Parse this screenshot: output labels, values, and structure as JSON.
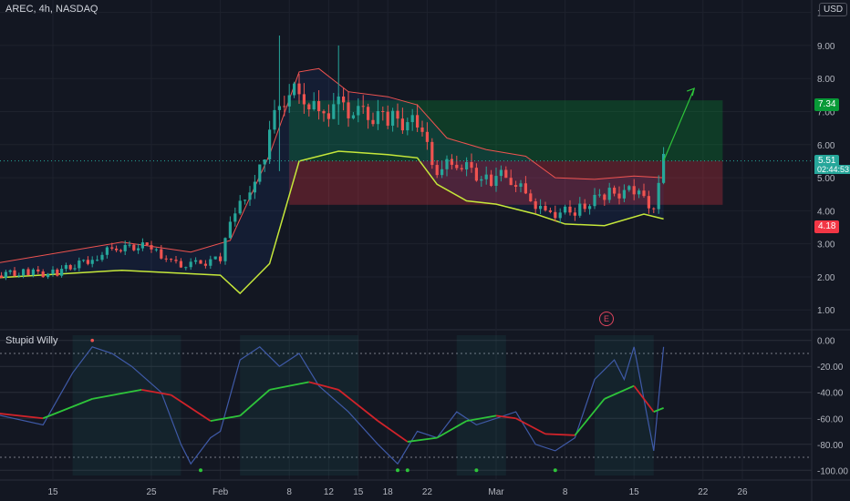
{
  "header": {
    "symbol": "AREC, 4h, NASDAQ",
    "currency": "USD"
  },
  "indicator": {
    "name": "Stupid Willy"
  },
  "price_tags": {
    "current": "5.51",
    "countdown": "02:44:53",
    "target": "7.34",
    "stop": "4.18"
  },
  "earnings_marker": "E",
  "colors": {
    "background": "#131722",
    "bull": "#26a69a",
    "bear": "#ef5350",
    "band_upper": "#ef5350",
    "band_lower": "#c6e83a",
    "osc": "#3f5aa8",
    "signal_green": "#2ec43a",
    "signal_red": "#d1232a",
    "target_zone": "#1b5e20",
    "stop_zone": "#7f1d1d"
  },
  "chart_data": [
    {
      "type": "candlestick",
      "title": "AREC, 4h, NASDAQ",
      "y_axis": {
        "ticks": [
          1.0,
          2.0,
          3.0,
          4.0,
          5.0,
          6.0,
          7.0,
          8.0,
          9.0,
          10.0
        ],
        "tick_labels": [
          "1.00",
          "2.00",
          "3.00",
          "4.00",
          "5.00",
          "6.00",
          "7.00",
          "8.00",
          "9.00",
          "10.00"
        ],
        "range": [
          0.4,
          10.1
        ]
      },
      "x_axis": {
        "tick_labels": [
          "15",
          "25",
          "Feb",
          "8",
          "12",
          "15",
          "18",
          "22",
          "Mar",
          "8",
          "15",
          "22",
          "26"
        ]
      },
      "close_path": [
        {
          "d": "2021-01-08",
          "v": 2.04
        },
        {
          "d": "2021-01-12",
          "v": 2.13
        },
        {
          "d": "2021-01-15",
          "v": 2.1
        },
        {
          "d": "2021-01-19",
          "v": 2.55
        },
        {
          "d": "2021-01-21",
          "v": 2.85
        },
        {
          "d": "2021-01-25",
          "v": 2.95
        },
        {
          "d": "2021-01-27",
          "v": 2.4
        },
        {
          "d": "2021-01-29",
          "v": 2.35
        },
        {
          "d": "2021-02-01",
          "v": 2.55
        },
        {
          "d": "2021-02-02",
          "v": 3.6
        },
        {
          "d": "2021-02-04",
          "v": 4.7
        },
        {
          "d": "2021-02-05",
          "v": 5.2
        },
        {
          "d": "2021-02-07",
          "v": 7.4
        },
        {
          "d": "2021-02-09",
          "v": 7.6
        },
        {
          "d": "2021-02-11",
          "v": 6.9
        },
        {
          "d": "2021-02-13",
          "v": 7.2
        },
        {
          "d": "2021-02-15",
          "v": 6.9
        },
        {
          "d": "2021-02-18",
          "v": 6.8
        },
        {
          "d": "2021-02-21",
          "v": 6.6
        },
        {
          "d": "2021-02-23",
          "v": 5.2
        },
        {
          "d": "2021-02-25",
          "v": 5.5
        },
        {
          "d": "2021-02-28",
          "v": 4.9
        },
        {
          "d": "2021-03-02",
          "v": 5.1
        },
        {
          "d": "2021-03-04",
          "v": 4.5
        },
        {
          "d": "2021-03-06",
          "v": 3.9
        },
        {
          "d": "2021-03-09",
          "v": 4.0
        },
        {
          "d": "2021-03-12",
          "v": 4.5
        },
        {
          "d": "2021-03-15",
          "v": 4.6
        },
        {
          "d": "2021-03-17",
          "v": 4.1
        },
        {
          "d": "2021-03-18",
          "v": 5.51
        }
      ],
      "bollinger_upper": [
        {
          "d": "2021-01-08",
          "v": 2.35
        },
        {
          "d": "2021-01-22",
          "v": 3.05
        },
        {
          "d": "2021-01-29",
          "v": 2.75
        },
        {
          "d": "2021-02-02",
          "v": 3.1
        },
        {
          "d": "2021-02-06",
          "v": 5.7
        },
        {
          "d": "2021-02-09",
          "v": 8.2
        },
        {
          "d": "2021-02-11",
          "v": 8.3
        },
        {
          "d": "2021-02-14",
          "v": 7.6
        },
        {
          "d": "2021-02-18",
          "v": 7.45
        },
        {
          "d": "2021-02-21",
          "v": 7.2
        },
        {
          "d": "2021-02-24",
          "v": 6.2
        },
        {
          "d": "2021-02-28",
          "v": 5.85
        },
        {
          "d": "2021-03-04",
          "v": 5.65
        },
        {
          "d": "2021-03-07",
          "v": 5.0
        },
        {
          "d": "2021-03-11",
          "v": 4.95
        },
        {
          "d": "2021-03-15",
          "v": 5.05
        },
        {
          "d": "2021-03-18",
          "v": 5.0
        }
      ],
      "bollinger_lower": [
        {
          "d": "2021-01-08",
          "v": 1.95
        },
        {
          "d": "2021-01-22",
          "v": 2.2
        },
        {
          "d": "2021-02-01",
          "v": 2.05
        },
        {
          "d": "2021-02-03",
          "v": 1.5
        },
        {
          "d": "2021-02-06",
          "v": 2.4
        },
        {
          "d": "2021-02-09",
          "v": 5.5
        },
        {
          "d": "2021-02-13",
          "v": 5.8
        },
        {
          "d": "2021-02-18",
          "v": 5.7
        },
        {
          "d": "2021-02-21",
          "v": 5.6
        },
        {
          "d": "2021-02-23",
          "v": 4.8
        },
        {
          "d": "2021-02-26",
          "v": 4.3
        },
        {
          "d": "2021-03-01",
          "v": 4.2
        },
        {
          "d": "2021-03-05",
          "v": 3.9
        },
        {
          "d": "2021-03-08",
          "v": 3.6
        },
        {
          "d": "2021-03-12",
          "v": 3.55
        },
        {
          "d": "2021-03-16",
          "v": 3.9
        },
        {
          "d": "2021-03-18",
          "v": 3.75
        }
      ],
      "annotations": {
        "target_zone": {
          "from": "2021-02-08",
          "to": "2021-03-24",
          "low": 5.51,
          "high": 7.34
        },
        "stop_zone": {
          "from": "2021-02-08",
          "to": "2021-03-24",
          "low": 4.18,
          "high": 5.51
        },
        "projection_arrow": [
          {
            "d": "2021-03-18",
            "v": 5.51
          },
          {
            "d": "2021-03-20",
            "v": 7.7
          }
        ],
        "last_price": 5.51,
        "target_price": 7.34,
        "stop_price": 4.18
      }
    },
    {
      "type": "line",
      "title": "Stupid Willy",
      "y_axis": {
        "ticks": [
          0,
          -20,
          -40,
          -60,
          -80,
          -100
        ],
        "tick_labels": [
          "0.00",
          "-20.00",
          "-40.00",
          "-60.00",
          "-80.00",
          "-100.00"
        ],
        "range": [
          -104,
          4
        ]
      },
      "series": [
        {
          "role": "oscillator",
          "points": [
            {
              "d": "2021-01-08",
              "v": -55
            },
            {
              "d": "2021-01-14",
              "v": -65
            },
            {
              "d": "2021-01-17",
              "v": -25
            },
            {
              "d": "2021-01-19",
              "v": -5
            },
            {
              "d": "2021-01-21",
              "v": -10
            },
            {
              "d": "2021-01-23",
              "v": -20
            },
            {
              "d": "2021-01-26",
              "v": -40
            },
            {
              "d": "2021-01-28",
              "v": -80
            },
            {
              "d": "2021-01-29",
              "v": -95
            },
            {
              "d": "2021-01-31",
              "v": -75
            },
            {
              "d": "2021-02-01",
              "v": -70
            },
            {
              "d": "2021-02-03",
              "v": -15
            },
            {
              "d": "2021-02-05",
              "v": -5
            },
            {
              "d": "2021-02-07",
              "v": -20
            },
            {
              "d": "2021-02-09",
              "v": -10
            },
            {
              "d": "2021-02-11",
              "v": -35
            },
            {
              "d": "2021-02-14",
              "v": -55
            },
            {
              "d": "2021-02-17",
              "v": -80
            },
            {
              "d": "2021-02-19",
              "v": -95
            },
            {
              "d": "2021-02-21",
              "v": -70
            },
            {
              "d": "2021-02-23",
              "v": -75
            },
            {
              "d": "2021-02-25",
              "v": -55
            },
            {
              "d": "2021-02-27",
              "v": -65
            },
            {
              "d": "2021-03-01",
              "v": -60
            },
            {
              "d": "2021-03-03",
              "v": -55
            },
            {
              "d": "2021-03-05",
              "v": -80
            },
            {
              "d": "2021-03-07",
              "v": -85
            },
            {
              "d": "2021-03-09",
              "v": -75
            },
            {
              "d": "2021-03-11",
              "v": -30
            },
            {
              "d": "2021-03-13",
              "v": -15
            },
            {
              "d": "2021-03-14",
              "v": -30
            },
            {
              "d": "2021-03-15",
              "v": -5
            },
            {
              "d": "2021-03-17",
              "v": -85
            },
            {
              "d": "2021-03-18",
              "v": -5
            }
          ]
        },
        {
          "role": "signal",
          "points": [
            {
              "d": "2021-01-08",
              "v": -55
            },
            {
              "d": "2021-01-14",
              "v": -60
            },
            {
              "d": "2021-01-19",
              "v": -45
            },
            {
              "d": "2021-01-24",
              "v": -38
            },
            {
              "d": "2021-01-27",
              "v": -42
            },
            {
              "d": "2021-01-31",
              "v": -62
            },
            {
              "d": "2021-02-03",
              "v": -58
            },
            {
              "d": "2021-02-06",
              "v": -38
            },
            {
              "d": "2021-02-10",
              "v": -32
            },
            {
              "d": "2021-02-13",
              "v": -38
            },
            {
              "d": "2021-02-17",
              "v": -62
            },
            {
              "d": "2021-02-20",
              "v": -78
            },
            {
              "d": "2021-02-23",
              "v": -75
            },
            {
              "d": "2021-02-26",
              "v": -62
            },
            {
              "d": "2021-03-01",
              "v": -58
            },
            {
              "d": "2021-03-03",
              "v": -60
            },
            {
              "d": "2021-03-06",
              "v": -72
            },
            {
              "d": "2021-03-09",
              "v": -73
            },
            {
              "d": "2021-03-12",
              "v": -45
            },
            {
              "d": "2021-03-15",
              "v": -35
            },
            {
              "d": "2021-03-17",
              "v": -55
            },
            {
              "d": "2021-03-18",
              "v": -52
            }
          ]
        }
      ],
      "dots_at_minus100": [
        "2021-01-30",
        "2021-02-19",
        "2021-02-20",
        "2021-02-27",
        "2021-03-07"
      ]
    }
  ]
}
